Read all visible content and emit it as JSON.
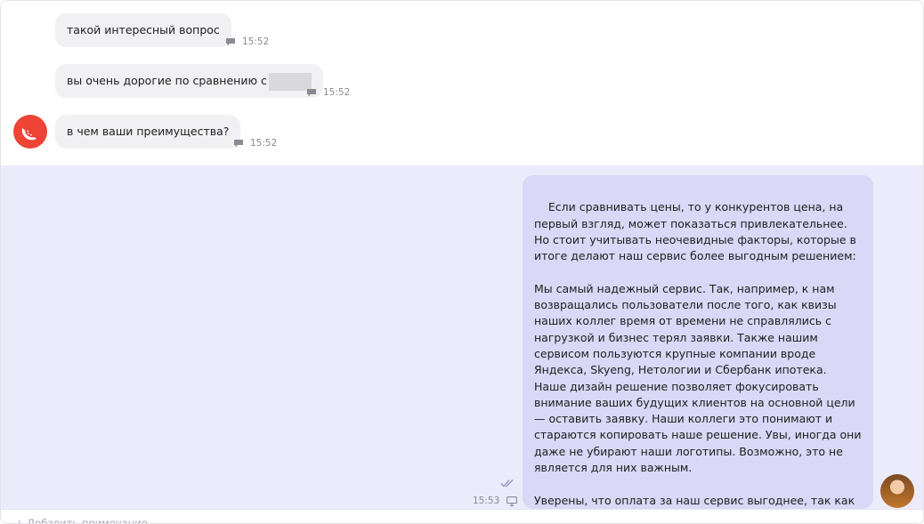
{
  "messages_in": [
    {
      "text": "такой интересный вопрос",
      "time": "15:52"
    },
    {
      "text": "вы очень дорогие по сравнению с",
      "time": "15:52"
    },
    {
      "text": "в чем ваши преимущества?",
      "time": "15:52"
    }
  ],
  "message_out": {
    "text": "Если сравнивать цены, то у конкурентов цена, на первый взгляд, может показаться привлекательнее. Но стоит учитывать неочевидные факторы, которые в итоге делают наш сервис более выгодным решением:\n\nМы самый надежный сервис. Так, например, к нам возвращались пользователи после того, как квизы наших коллег время от времени не справлялись с нагрузкой и бизнес терял заявки. Также нашим сервисом пользуются крупные компании вроде Яндекса, Skyeng, Нетологии и Сбербанк ипотека.\nНаше дизайн решение позволяет фокусировать внимание ваших будущих клиентов на основной цели — оставить заявку. Наши коллеги это понимают и стараются копировать наше решение. Увы, иногда они даже не убирают наши логотипы. Возможно, это не является для них важным.\n\nУверены, что оплата за наш сервис выгоднее, так как в итоге, вы получите больший результат",
    "time": "15:53"
  },
  "footer": {
    "add_note": "+ Добавить примечание"
  },
  "colors": {
    "outgoing_bg": "#ecebfb",
    "bubble_out": "#d9d8f6",
    "bubble_in": "#f1f1f3",
    "bot_avatar": "#ee4436"
  },
  "icons": {
    "comment": "comment-icon",
    "read_status": "double-check-icon",
    "channel": "monitor-icon",
    "bot_avatar": "watermelon-icon"
  }
}
